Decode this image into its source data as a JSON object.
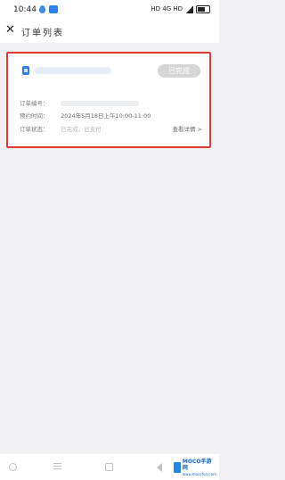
{
  "status_bar": {
    "time": "10:44",
    "indicators": "HD 4G HD"
  },
  "header": {
    "close_icon": "close-icon",
    "title": "订单列表"
  },
  "order": {
    "status": "已完成",
    "rows": [
      {
        "label": "订单编号：",
        "value": ""
      },
      {
        "label": "预约时间：",
        "value": "2024年5月18日上午10:00-11:00"
      },
      {
        "label": "订单状态：",
        "value": "已完成，已支付"
      }
    ],
    "detail_link": "查看详情 >",
    "accent_color": "#e53935"
  },
  "bottom_nav": {
    "items": [
      "info-icon",
      "menu-icon",
      "home-icon",
      "back-icon"
    ]
  },
  "watermark": {
    "title": "MOCO手游网",
    "subtitle": "www.mocofun.com"
  }
}
